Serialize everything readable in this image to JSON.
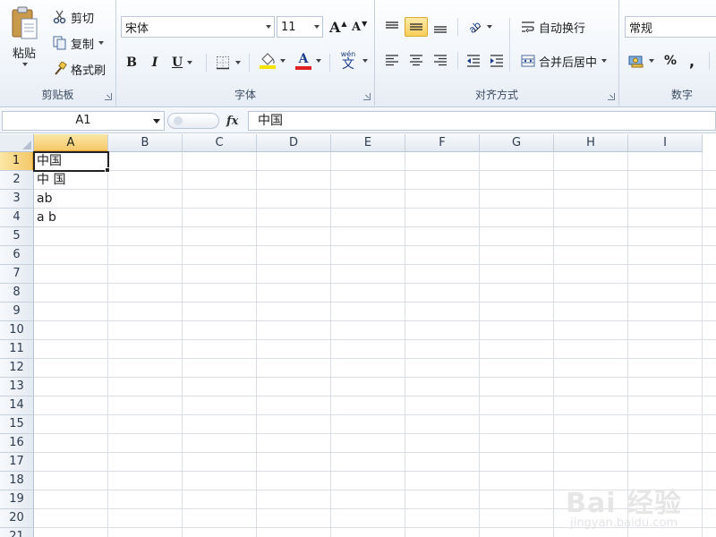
{
  "ribbon": {
    "clipboard": {
      "label": "剪贴板",
      "paste_label": "粘贴",
      "cut_label": "剪切",
      "copy_label": "复制",
      "format_painter_label": "格式刷"
    },
    "font": {
      "label": "字体",
      "font_name": "宋体",
      "font_size": "11",
      "bold": "B",
      "italic": "I",
      "underline": "U",
      "grow_font": "A",
      "shrink_font": "A",
      "font_color_letter": "A",
      "font_color": "#e02020",
      "highlight_color": "#f5e400",
      "phonetic_label": "wén"
    },
    "alignment": {
      "label": "对齐方式",
      "wrap_text_label": "自动换行",
      "merge_center_label": "合并后居中",
      "selected": "middle-align"
    },
    "number": {
      "label": "数字",
      "format": "常规",
      "percent": "%",
      "comma": ","
    }
  },
  "formula_bar": {
    "name_box": "A1",
    "fx_label": "fx",
    "content": "中国"
  },
  "sheet": {
    "active_cell": "A1",
    "columns": [
      "A",
      "B",
      "C",
      "D",
      "E",
      "F",
      "G",
      "H",
      "I"
    ],
    "rows": [
      "1",
      "2",
      "3",
      "4",
      "5",
      "6",
      "7",
      "8",
      "9",
      "10",
      "11",
      "12",
      "13",
      "14",
      "15",
      "16",
      "17",
      "18",
      "19",
      "20",
      "21"
    ],
    "cells": {
      "A1": "中国",
      "A2": "中 国",
      "A3": "ab",
      "A4": "a b"
    }
  },
  "watermark": {
    "main": "Bai 经验",
    "sub": "jingyan.baidu.com"
  }
}
